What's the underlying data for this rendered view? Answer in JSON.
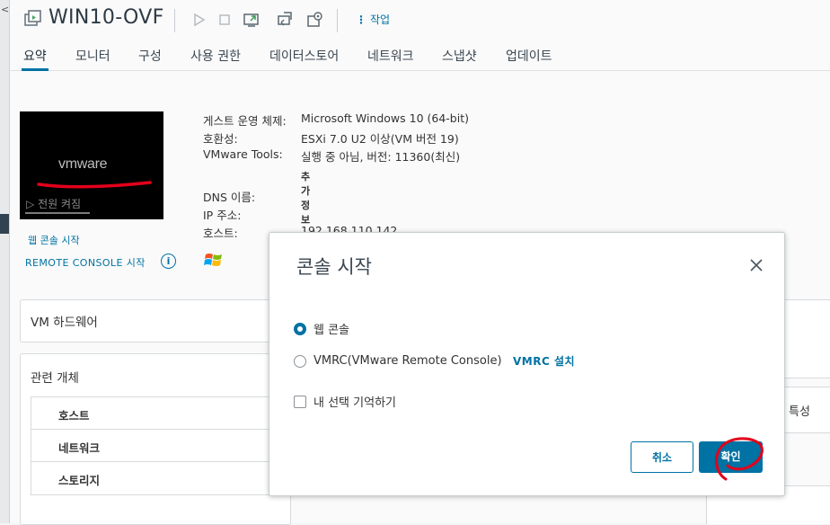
{
  "left_strip": {
    "caret": "<"
  },
  "header": {
    "vm_name": "WIN10-OVF",
    "actions_label": "작업",
    "actions_dots": "⋮"
  },
  "tabs": [
    {
      "label": "요약",
      "active": true
    },
    {
      "label": "모니터"
    },
    {
      "label": "구성"
    },
    {
      "label": "사용 권한"
    },
    {
      "label": "데이터스토어"
    },
    {
      "label": "네트워크"
    },
    {
      "label": "스냅샷"
    },
    {
      "label": "업데이트"
    }
  ],
  "console": {
    "logo_text": "vmware",
    "power_state": "전원 켜짐",
    "power_icon": "▷",
    "web_console_link": "웹 콘솔 시작",
    "remote_console_link": "REMOTE CONSOLE 시작",
    "info_icon": "i"
  },
  "properties": {
    "guest_os_label": "게스트 운영 체제:",
    "guest_os_value": "Microsoft Windows 10 (64-bit)",
    "compat_label": "호환성:",
    "compat_value": "ESXi 7.0 U2 이상(VM 버전 19)",
    "tools_label": "VMware Tools:",
    "tools_value": "실행 중 아님, 버전: 11360(최신)",
    "more_info": "추가 정보",
    "dns_label": "DNS 이름:",
    "ip_label": "IP 주소:",
    "host_label": "호스트:",
    "host_value": "192.168.110.142"
  },
  "cards": {
    "hardware_title": "VM 하드웨어",
    "related_title": "관련 개체",
    "related_rows": [
      "호스트",
      "네트워크",
      "스토리지"
    ],
    "right_partial": "특성"
  },
  "modal": {
    "title": "콘솔 시작",
    "option_web": "웹 콘솔",
    "option_vmrc": "VMRC(VMware Remote Console)",
    "vmrc_install": "VMRC 설치",
    "remember": "내 선택 기억하기",
    "cancel": "취소",
    "ok": "확인",
    "selected": "web"
  },
  "colors": {
    "accent": "#0072a3",
    "annotation": "#e3001b"
  }
}
